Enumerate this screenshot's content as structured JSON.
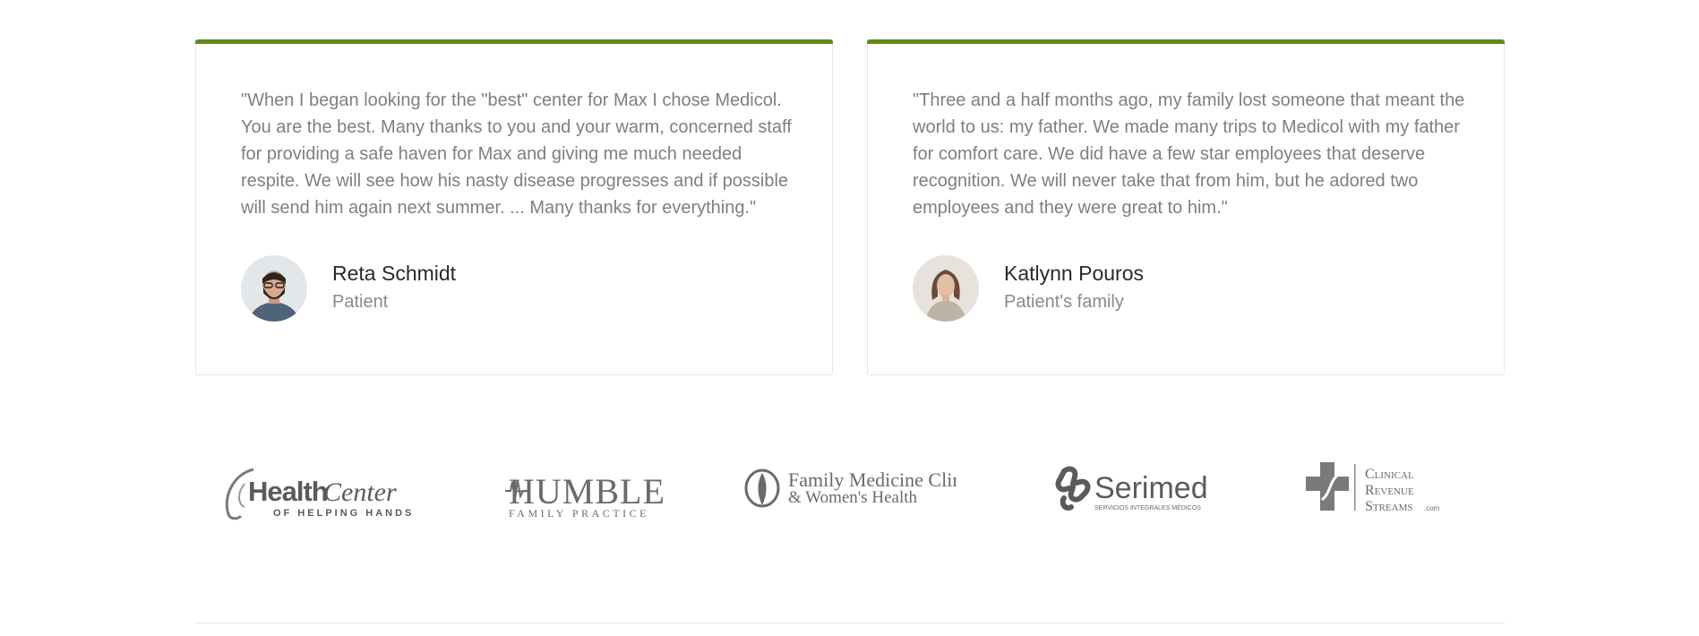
{
  "testimonials": [
    {
      "quote": "\"When I began looking for the \"best\" center for Max I chose Medicol. You are the best. Many thanks to you and your warm, concerned staff for providing a safe haven for Max and giving me much needed respite. We will see how his nasty disease progresses and if possible will send him again next summer. ... Many thanks for everything.\"",
      "name": "Reta Schmidt",
      "role": "Patient"
    },
    {
      "quote": "\"Three and a half months ago, my family lost someone that meant the world to us: my father. We made many trips to Medicol with my father for comfort care. We did have a few star employees that deserve recognition. We will never take that from him, but he adored two employees and they were great to him.\"",
      "name": "Katlynn Pouros",
      "role": "Patient's family"
    }
  ],
  "partners": {
    "health_center": {
      "line1": "Health",
      "line2": "Center",
      "tagline": "OF HELPING HANDS"
    },
    "humble": {
      "name": "HUMBLE",
      "tagline": "FAMILY PRACTICE"
    },
    "family_medicine": {
      "line1": "Family Medicine Clinic",
      "line2": "& Women's Health"
    },
    "serimed": {
      "name": "Serimed",
      "tagline": "SERVICIOS INTEGRALES MÉDICOS"
    },
    "clinical_revenue": {
      "line1": "Clinical",
      "line2": "Revenue",
      "line3": "Streams",
      "suffix": ".com"
    }
  },
  "colors": {
    "accent": "#5e8b15",
    "logo_gray": "#6b6b6b"
  }
}
